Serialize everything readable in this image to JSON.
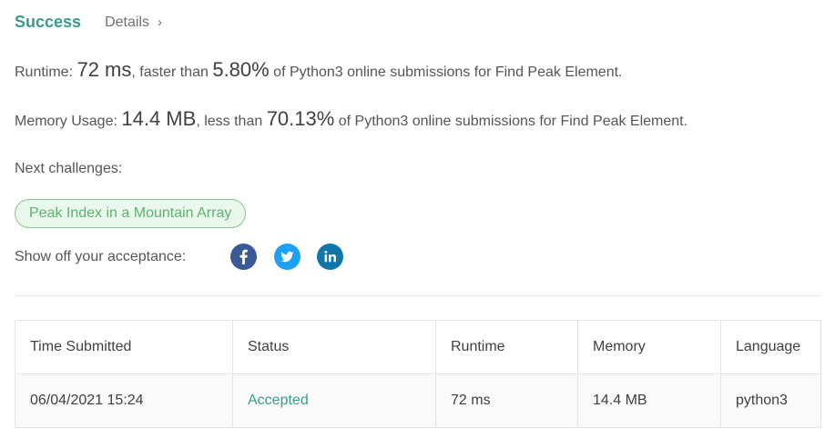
{
  "header": {
    "success_label": "Success",
    "details_label": "Details",
    "details_chevron": "›"
  },
  "runtime": {
    "label": "Runtime: ",
    "value": "72 ms",
    "connector": ", faster than ",
    "percent": "5.80%",
    "suffix": " of Python3 online submissions for Find Peak Element."
  },
  "memory": {
    "label": "Memory Usage: ",
    "value": "14.4 MB",
    "connector": ", less than ",
    "percent": "70.13%",
    "suffix": " of Python3 online submissions for Find Peak Element."
  },
  "next_challenges": {
    "label": "Next challenges:",
    "items": [
      "Peak Index in a Mountain Array"
    ]
  },
  "share": {
    "label": "Show off your acceptance:",
    "icons": [
      "facebook-icon",
      "twitter-icon",
      "linkedin-icon"
    ]
  },
  "table": {
    "headers": [
      "Time Submitted",
      "Status",
      "Runtime",
      "Memory",
      "Language"
    ],
    "rows": [
      [
        "06/04/2021 15:24",
        "Accepted",
        "72 ms",
        "14.4 MB",
        "python3"
      ]
    ]
  },
  "colors": {
    "success": "#3a9a8d",
    "accepted": "#3a9a8d",
    "pill_border": "#7fc58f",
    "pill_bg": "#eaf7ec",
    "pill_text": "#5cb46e",
    "facebook": "#3b5998",
    "twitter": "#1da1f2",
    "linkedin": "#0e76a8"
  }
}
